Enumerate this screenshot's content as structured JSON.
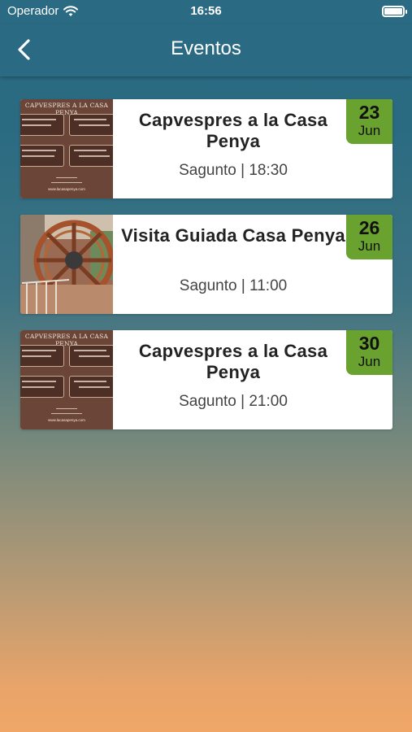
{
  "status": {
    "carrier": "Operador",
    "time": "16:56"
  },
  "nav": {
    "title": "Eventos",
    "back_icon": "chevron-left-icon"
  },
  "colors": {
    "nav_bg": "#2a6a82",
    "badge_bg": "#6aa22f",
    "gradient_bottom": "#f0a666"
  },
  "events": [
    {
      "name": "Capvespres a la Casa Penya",
      "place_time": "Sagunto | 18:30",
      "day": "23",
      "month": "Jun",
      "image": "poster"
    },
    {
      "name": "Visita Guiada Casa Penya",
      "place_time": "Sagunto | 11:00",
      "day": "26",
      "month": "Jun",
      "image": "wheel"
    },
    {
      "name": "Capvespres a la Casa Penya",
      "place_time": "Sagunto | 21:00",
      "day": "30",
      "month": "Jun",
      "image": "poster"
    }
  ],
  "poster": {
    "heading": "CAPVESPRES A LA CASA PENYA",
    "site": "www.lacasapenya.com"
  }
}
